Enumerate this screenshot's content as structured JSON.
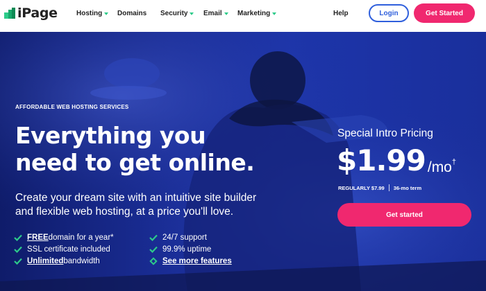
{
  "brand": {
    "name": "iPage",
    "logo_colors": [
      "#2dcb8a",
      "#0e8a54"
    ]
  },
  "nav": {
    "items": [
      {
        "label": "Hosting",
        "has_dropdown": true
      },
      {
        "label": "Domains",
        "has_dropdown": false
      },
      {
        "label": "Security",
        "has_dropdown": true
      },
      {
        "label": "Email",
        "has_dropdown": true
      },
      {
        "label": "Marketing",
        "has_dropdown": true
      }
    ],
    "help": "Help",
    "login": "Login",
    "get_started": "Get Started"
  },
  "hero": {
    "eyebrow": "AFFORDABLE WEB HOSTING SERVICES",
    "headline_line1": "Everything you",
    "headline_line2": "need to get online.",
    "subtext_line1": "Create your dream site with an intuitive site builder",
    "subtext_line2": "and flexible web hosting, at a price you'll love.",
    "features_left": [
      {
        "strong": "FREE",
        "rest": " domain for a year*"
      },
      {
        "strong": "",
        "rest": "SSL certificate included"
      },
      {
        "strong": "Unlimited",
        "rest": " bandwidth"
      }
    ],
    "features_right": [
      {
        "text": "24/7 support"
      },
      {
        "text": "99.9% uptime"
      }
    ],
    "see_more": "See more features",
    "pricing": {
      "label": "Special Intro Pricing",
      "amount": "$1.99",
      "unit": "/mo",
      "dagger": "†",
      "regular": "REGULARLY $7.99",
      "term": "36-mo term",
      "cta": "Get started"
    }
  },
  "colors": {
    "accent_pink": "#f0286f",
    "accent_blue": "#2f5fdc",
    "check_green": "#2dcb8a",
    "hero_blue": "#1d35aa"
  }
}
